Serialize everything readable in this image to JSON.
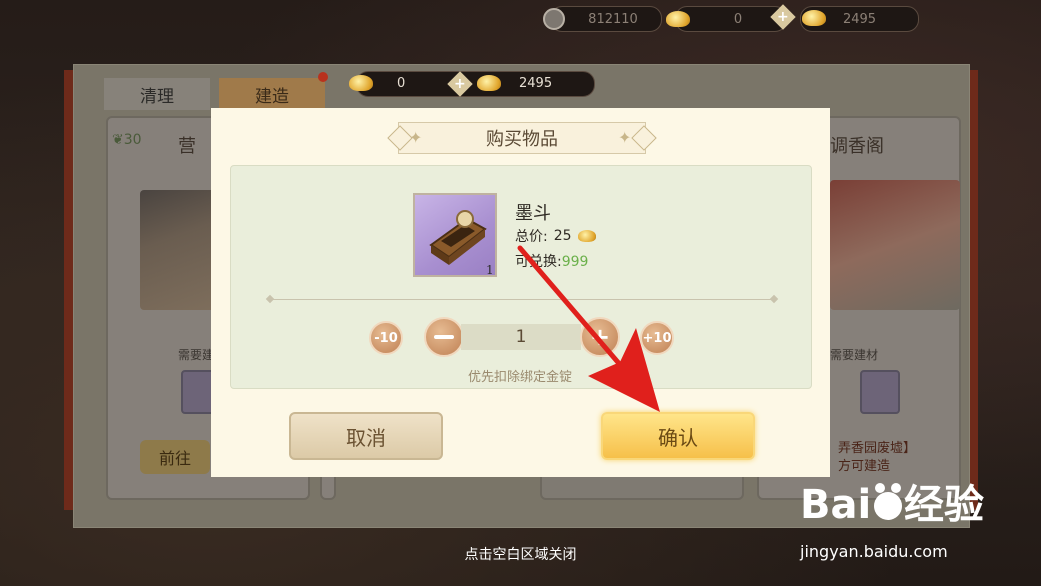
{
  "top_currency": {
    "coins": "812110",
    "bound_ingots": "0",
    "ingots": "2495"
  },
  "background": {
    "tabs": [
      "清理",
      "建造"
    ],
    "leaf_count": "30",
    "card_title_partial": "营",
    "card_title_right": "调香阁",
    "materials_label": "需要建材",
    "goto_button": "前往",
    "unlock_note": "弄香园废墟】\n方可建造"
  },
  "dialog_currency": {
    "bound_ingots": "0",
    "ingots": "2495"
  },
  "dialog": {
    "title": "购买物品",
    "item": {
      "name": "墨斗",
      "quantity_badge": "1",
      "total_price_label": "总价:",
      "total_price": "25",
      "redeemable_label": "可兑换:",
      "redeemable": "999"
    },
    "stepper": {
      "minus10": "-10",
      "value": "1",
      "plus10": "+10"
    },
    "hint": "优先扣除绑定金锭",
    "cancel_label": "取消",
    "confirm_label": "确认"
  },
  "close_hint": "点击空白区域关闭",
  "watermark": {
    "url": "jingyan.baidu.com"
  },
  "colors": {
    "dialog_bg": "#fdf8e6",
    "confirm_gold": "#f6c04a",
    "redeem_green": "#6bb04a",
    "annotation_red": "#e0201c"
  }
}
